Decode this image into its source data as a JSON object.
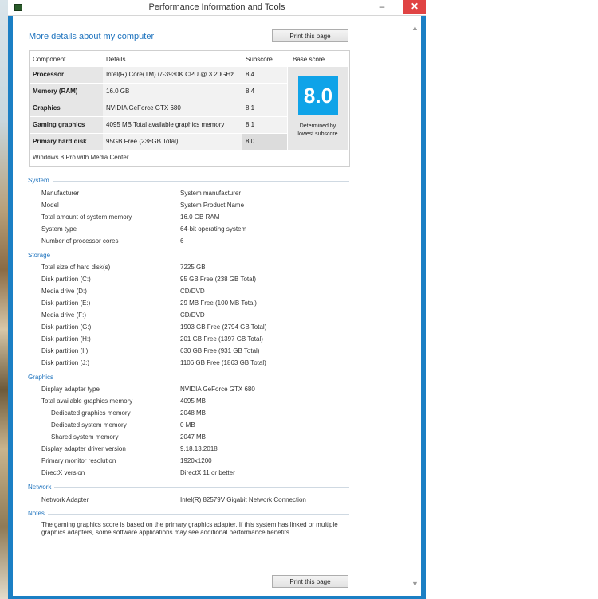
{
  "window": {
    "title": "Performance Information and Tools",
    "minimize": "–",
    "maximize": "",
    "close": "✕"
  },
  "heading": "More details about my computer",
  "print_button": "Print this page",
  "score_table": {
    "headers": {
      "component": "Component",
      "details": "Details",
      "subscore": "Subscore",
      "base": "Base score"
    },
    "rows": [
      {
        "component": "Processor",
        "details": "Intel(R) Core(TM) i7-3930K CPU @ 3.20GHz",
        "subscore": "8.4"
      },
      {
        "component": "Memory (RAM)",
        "details": "16.0 GB",
        "subscore": "8.4"
      },
      {
        "component": "Graphics",
        "details": "NVIDIA GeForce GTX 680",
        "subscore": "8.1"
      },
      {
        "component": "Gaming graphics",
        "details": "4095 MB Total available graphics memory",
        "subscore": "8.1"
      },
      {
        "component": "Primary hard disk",
        "details": "95GB Free (238GB Total)",
        "subscore": "8.0"
      }
    ],
    "base_score": "8.0",
    "base_note_1": "Determined by",
    "base_note_2": "lowest subscore",
    "edition": "Windows 8 Pro with Media Center",
    "accent_color": "#0fa3e8"
  },
  "system": {
    "title": "System",
    "rows": [
      {
        "label": "Manufacturer",
        "value": "System manufacturer"
      },
      {
        "label": "Model",
        "value": "System Product Name"
      },
      {
        "label": "Total amount of system memory",
        "value": "16.0 GB RAM"
      },
      {
        "label": "System type",
        "value": "64-bit operating system"
      },
      {
        "label": "Number of processor cores",
        "value": "6"
      }
    ]
  },
  "storage": {
    "title": "Storage",
    "rows": [
      {
        "label": "Total size of hard disk(s)",
        "value": "7225 GB"
      },
      {
        "label": "Disk partition (C:)",
        "value": "95 GB Free (238 GB Total)"
      },
      {
        "label": "Media drive (D:)",
        "value": "CD/DVD"
      },
      {
        "label": "Disk partition (E:)",
        "value": "29 MB Free (100 MB Total)"
      },
      {
        "label": "Media drive (F:)",
        "value": "CD/DVD"
      },
      {
        "label": "Disk partition (G:)",
        "value": "1903 GB Free (2794 GB Total)"
      },
      {
        "label": "Disk partition (H:)",
        "value": "201 GB Free (1397 GB Total)"
      },
      {
        "label": "Disk partition (I:)",
        "value": "630 GB Free (931 GB Total)"
      },
      {
        "label": "Disk partition (J:)",
        "value": "1106 GB Free (1863 GB Total)"
      }
    ]
  },
  "graphics": {
    "title": "Graphics",
    "rows": [
      {
        "label": "Display adapter type",
        "value": "NVIDIA GeForce GTX 680"
      },
      {
        "label": "Total available graphics memory",
        "value": "4095 MB"
      },
      {
        "label": "Dedicated graphics memory",
        "value": "2048 MB"
      },
      {
        "label": "Dedicated system memory",
        "value": "0 MB"
      },
      {
        "label": "Shared system memory",
        "value": "2047 MB"
      },
      {
        "label": "Display adapter driver version",
        "value": "9.18.13.2018"
      },
      {
        "label": "Primary monitor resolution",
        "value": "1920x1200"
      },
      {
        "label": "DirectX version",
        "value": "DirectX 11 or better"
      }
    ]
  },
  "network": {
    "title": "Network",
    "rows": [
      {
        "label": "Network Adapter",
        "value": "Intel(R) 82579V Gigabit Network Connection"
      }
    ]
  },
  "notes": {
    "title": "Notes",
    "text": "The gaming graphics score is based on the primary graphics adapter. If this system has linked or multiple graphics adapters, some software applications may see additional performance benefits."
  }
}
